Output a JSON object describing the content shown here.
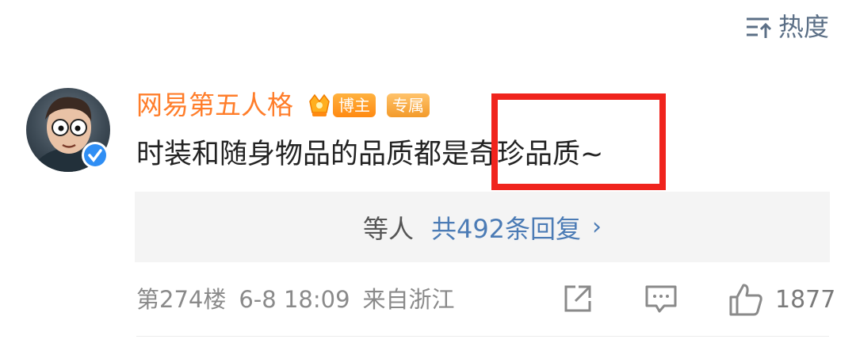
{
  "sort": {
    "label": "热度",
    "icon": "sort-icon"
  },
  "comment": {
    "username": "网易第五人格",
    "badges": [
      "博主",
      "专属"
    ],
    "text": "时装和随身物品的品质都是奇珍品质~",
    "replies": {
      "who": "等人",
      "count_label": "共492条回复"
    },
    "floor": "第274楼",
    "time": "6-8 18:09",
    "location": "来自浙江",
    "likes": "1877"
  },
  "colors": {
    "username": "#ff7d2a",
    "link": "#4b7bb5",
    "highlight_box": "#f0241d",
    "verified": "#2f8ef4"
  },
  "icons": [
    "sort-icon",
    "crown-icon",
    "verified-icon",
    "chevron-right-icon",
    "share-icon",
    "comment-icon",
    "like-icon"
  ]
}
